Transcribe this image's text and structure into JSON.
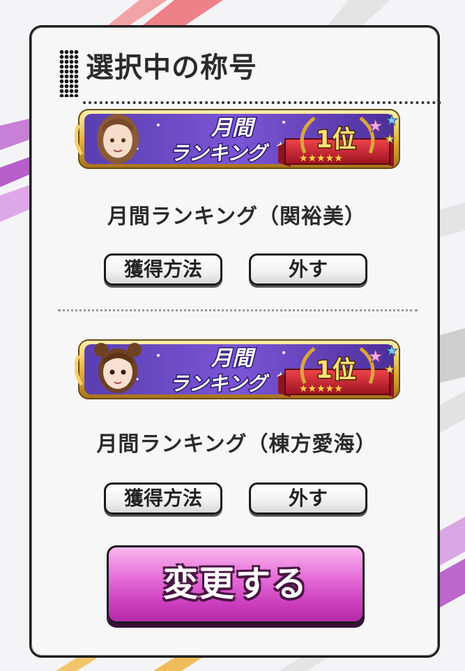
{
  "panel": {
    "title": "選択中の称号"
  },
  "titles": [
    {
      "banner_text_top": "月間",
      "banner_text_bottom": "ランキング",
      "rank_text": "1位",
      "label": "月間ランキング（関裕美）",
      "method_button": "獲得方法",
      "remove_button": "外す"
    },
    {
      "banner_text_top": "月間",
      "banner_text_bottom": "ランキング",
      "rank_text": "1位",
      "label": "月間ランキング（棟方愛海）",
      "method_button": "獲得方法",
      "remove_button": "外す"
    }
  ],
  "change_button": "変更する",
  "colors": {
    "banner_purple": "#3b2a8c",
    "banner_gold": "#e8b53a",
    "rank_red": "#c8202a",
    "change_pink": "#d84ccb"
  }
}
